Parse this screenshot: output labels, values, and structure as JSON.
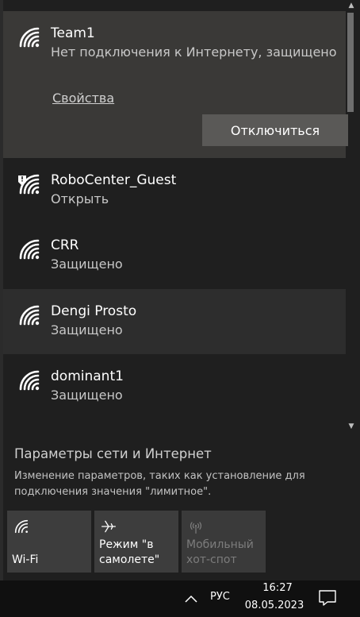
{
  "networks": [
    {
      "name": "Team1",
      "status": "Нет подключения к Интернету, защищено",
      "connected": true,
      "icon": "wifi-icon"
    },
    {
      "name": "RoboCenter_Guest",
      "status": "Открыть",
      "icon": "wifi-warning-icon"
    },
    {
      "name": "CRR",
      "status": "Защищено",
      "icon": "wifi-icon"
    },
    {
      "name": "Dengi Prosto",
      "status": "Защищено",
      "icon": "wifi-icon"
    },
    {
      "name": "dominant1",
      "status": "Защищено",
      "icon": "wifi-icon"
    }
  ],
  "connected_actions": {
    "properties_link": "Свойства",
    "disconnect_button": "Отключиться"
  },
  "settings": {
    "title": "Параметры сети и Интернет",
    "description": "Изменение параметров, таких как установление для подключения значения \"лимитное\"."
  },
  "quick_actions": [
    {
      "label": "Wi-Fi",
      "icon": "wifi-icon",
      "enabled": true
    },
    {
      "label": "Режим \"в самолете\"",
      "icon": "airplane-icon",
      "enabled": true
    },
    {
      "label": "Мобильный хот-спот",
      "icon": "hotspot-icon",
      "enabled": false
    }
  ],
  "taskbar": {
    "language": "РУС",
    "time": "16:27",
    "date": "08.05.2023"
  },
  "colors": {
    "panel_bg": "#1f1f1f",
    "connected_bg": "#3a3937",
    "tile_bg": "#3d3d3d",
    "taskbar_bg": "#101010"
  }
}
